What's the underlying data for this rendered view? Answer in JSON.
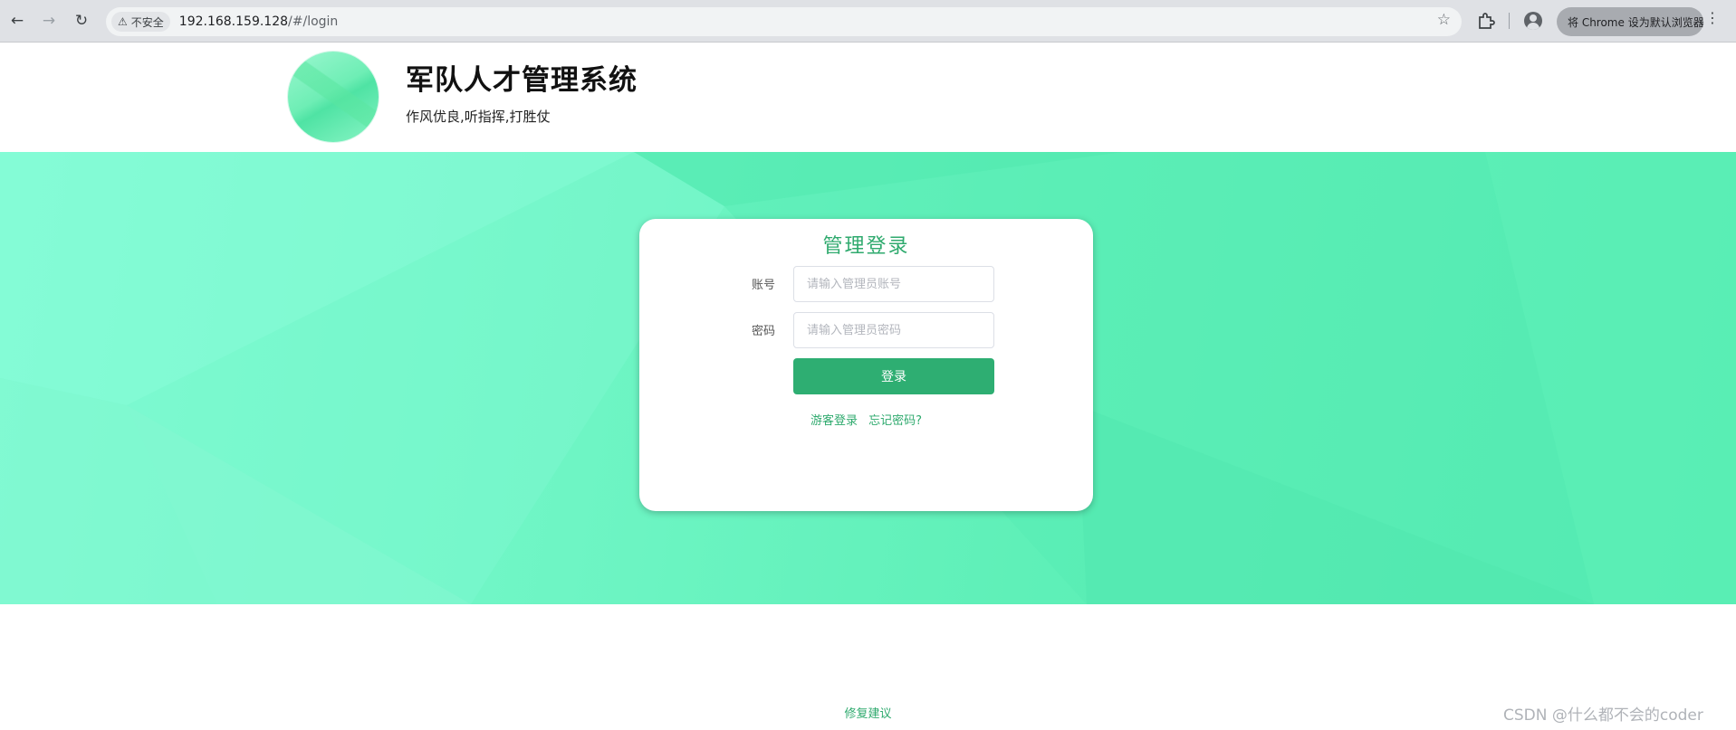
{
  "browser": {
    "security_label": "不安全",
    "url_host": "192.168.159.128",
    "url_path": "/#/login",
    "default_browser_button": "将 Chrome 设为默认浏览器"
  },
  "header": {
    "title": "军队人才管理系统",
    "slogan": "作风优良,听指挥,打胜仗"
  },
  "login": {
    "title": "管理登录",
    "account_label": "账号",
    "account_placeholder": "请输入管理员账号",
    "account_value": "",
    "password_label": "密码",
    "password_placeholder": "请输入管理员密码",
    "password_value": "",
    "submit_label": "登录",
    "guest_link": "游客登录",
    "forgot_link": "忘记密码?"
  },
  "footer": {
    "feedback_link": "修复建议"
  },
  "watermark": "CSDN @什么都不会的coder",
  "colors": {
    "accent": "#2faa6e",
    "button": "#2eae72",
    "banner": "#5ff0b8"
  }
}
